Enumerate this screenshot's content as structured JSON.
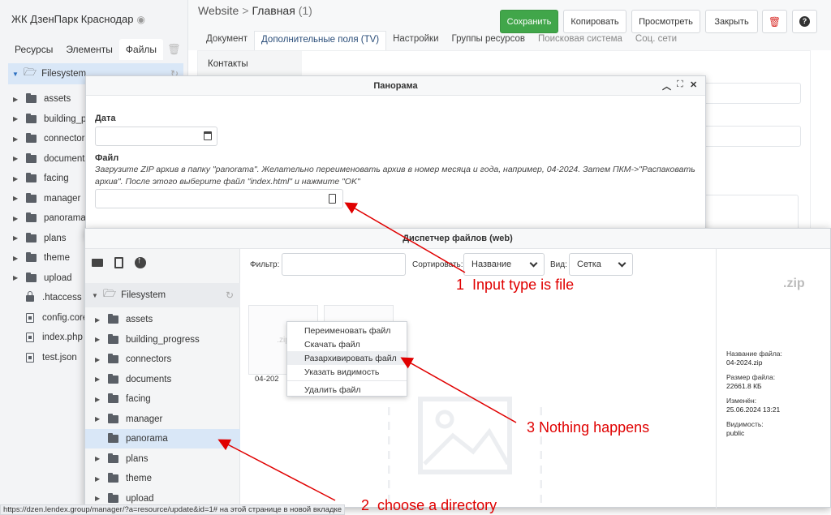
{
  "left": {
    "site_title": "ЖК ДзенПарк Краснодар",
    "tabs": [
      "Ресурсы",
      "Элементы",
      "Файлы"
    ],
    "root_label": "Filesystem",
    "folders": [
      "assets",
      "building_pr",
      "connectors",
      "documents",
      "facing",
      "manager",
      "panorama",
      "plans",
      "theme",
      "upload"
    ],
    "files": [
      {
        "name": ".htaccess",
        "icon": "lock-icon"
      },
      {
        "name": "config.core",
        "icon": "code-file-icon"
      },
      {
        "name": "index.php",
        "icon": "code-file-icon"
      },
      {
        "name": "test.json",
        "icon": "code-file-icon"
      }
    ]
  },
  "header": {
    "crumb_site": "Website",
    "crumb_sep": ">",
    "crumb_page": "Главная",
    "crumb_count": "(1)",
    "buttons": {
      "save": "Сохранить",
      "copy": "Копировать",
      "view": "Просмотреть",
      "close": "Закрыть"
    },
    "tabs": [
      "Документ",
      "Дополнительные поля (TV)",
      "Настройки",
      "Группы ресурсов",
      "Поисковая система",
      "Соц. сети"
    ],
    "subnav_item": "Контакты",
    "accent": "#41a64a",
    "delete_color": "#d9302c"
  },
  "panorama": {
    "title": "Панорама",
    "date_label": "Дата",
    "file_label": "Файл",
    "hint": "Загрузите ZIP архив в папку \"panorama\". Желательно переименовать архив в номер месяца и года, например, 04-2024. Затем ПКМ->\"Распаковать архив\". После этого выберите файл \"index.html\" и нажмите \"OK\""
  },
  "file_manager": {
    "title": "Диспетчер файлов (web)",
    "root_label": "Filesystem",
    "folders": [
      "assets",
      "building_progress",
      "connectors",
      "documents",
      "facing",
      "manager",
      "panorama",
      "plans",
      "theme",
      "upload"
    ],
    "selected_folder": "panorama",
    "filter_label": "Фильтр:",
    "filter_value": "",
    "sort_label": "Сортировать:",
    "sort_value": "Название",
    "view_label": "Вид:",
    "view_value": "Сетка",
    "thumb_ext": ".zip",
    "thumb_label": "04-202",
    "context_menu": [
      "Переименовать файл",
      "Скачать файл",
      "Разархивировать файл",
      "Указать видимость",
      "Удалить файл"
    ],
    "context_highlighted": "Разархивировать файл",
    "info": {
      "preview_ext": ".zip",
      "name_label": "Название файла:",
      "name_value": "04-2024.zip",
      "size_label": "Размер файла:",
      "size_value": "22661.8 КБ",
      "modified_label": "Изменён:",
      "modified_value": "25.06.2024 13:21",
      "visibility_label": "Видимость:",
      "visibility_value": "public"
    }
  },
  "annotations": [
    {
      "num": "1",
      "text": "Input type is file"
    },
    {
      "num": "2",
      "text": "choose a directory"
    },
    {
      "num": "3",
      "text": "Nothing happens"
    }
  ],
  "annotation_color": "#e00000",
  "status_bar": {
    "url": "https://dzen.lendex.group/manager/?a=resource/update&id=1#",
    "suffix": " на этой странице в новой вкладке"
  }
}
